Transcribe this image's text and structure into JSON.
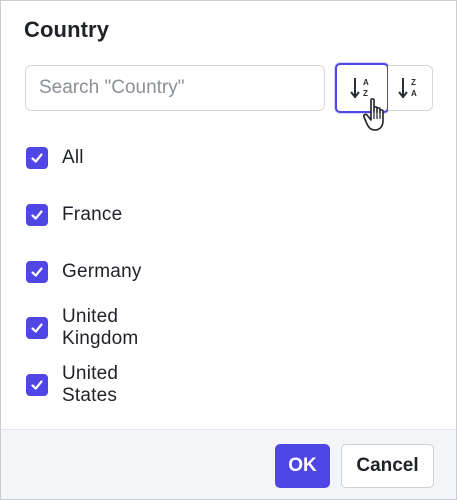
{
  "filter": {
    "title": "Country",
    "search_placeholder": "Search \"Country\"",
    "search_value": "",
    "sort_asc_icon": "sort-a-z-icon",
    "sort_desc_icon": "sort-z-a-icon",
    "options": [
      {
        "label": "All",
        "checked": true
      },
      {
        "label": "France",
        "checked": true
      },
      {
        "label": "Germany",
        "checked": true
      },
      {
        "label": "United Kingdom",
        "checked": true
      },
      {
        "label": "United States",
        "checked": true
      }
    ]
  },
  "footer": {
    "ok_label": "OK",
    "cancel_label": "Cancel"
  },
  "colors": {
    "accent": "#4f46e5",
    "footer_bg": "#f3f5f9",
    "border": "#d3d6dc"
  }
}
